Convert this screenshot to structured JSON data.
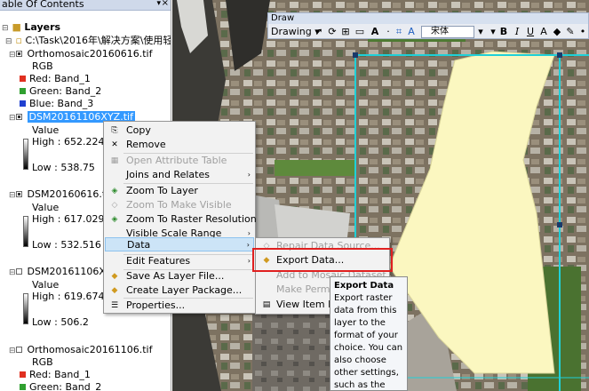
{
  "toc": {
    "title": "able Of Contents",
    "pin": "▾",
    "close": "×",
    "root": "Layers",
    "path": "C:\\Task\\2016年\\解决方案\\使用轻小¦",
    "layers": [
      {
        "name": "Orthomosaic20160616.tif",
        "mode": "RGB",
        "red": "Red:   Band_1",
        "green": "Green: Band_2",
        "blue": "Blue:  Band_3"
      },
      {
        "name": "DSM20161106XYZ.tif",
        "value": "Value",
        "high": "High : 652.224",
        "low": "Low : 538.75"
      },
      {
        "name": "DSM20160616.tif",
        "value": "Value",
        "high": "High : 617.029",
        "low": "Low : 532.516"
      },
      {
        "name": "DSM20161106XY.t",
        "value": "Value",
        "high": "High : 619.674",
        "low": "Low : 506.2"
      },
      {
        "name": "Orthomosaic20161106.tif",
        "mode": "RGB",
        "red": "Red:   Band_1",
        "green": "Green: Band_2"
      }
    ],
    "colors": {
      "red": "#e03020",
      "green": "#30a030",
      "blue": "#2040d0",
      "selection": "#3399ff"
    }
  },
  "draw": {
    "title": "Draw",
    "label": "Drawing",
    "font": "宋体",
    "bold": "B",
    "italic": "I",
    "underline": "U",
    "text": "A"
  },
  "context_menu": {
    "items": [
      {
        "label": "Copy",
        "icon": "copy-icon",
        "enabled": true
      },
      {
        "label": "Remove",
        "icon": "remove-icon",
        "enabled": true
      },
      {
        "label": "Open Attribute Table",
        "icon": "table-icon",
        "enabled": false
      },
      {
        "label": "Joins and Relates",
        "icon": "",
        "enabled": true,
        "submenu": true
      },
      {
        "label": "Zoom To Layer",
        "icon": "zoom-layer-icon",
        "enabled": true
      },
      {
        "label": "Zoom To Make Visible",
        "icon": "zoom-visible-icon",
        "enabled": false
      },
      {
        "label": "Zoom To Raster Resolution",
        "icon": "zoom-resolution-icon",
        "enabled": true
      },
      {
        "label": "Visible Scale Range",
        "icon": "",
        "enabled": true,
        "submenu": true
      },
      {
        "label": "Data",
        "icon": "",
        "enabled": true,
        "submenu": true,
        "highlighted": true
      },
      {
        "label": "Edit Features",
        "icon": "",
        "enabled": true,
        "submenu": true
      },
      {
        "label": "Save As Layer File...",
        "icon": "save-layer-icon",
        "enabled": true
      },
      {
        "label": "Create Layer Package...",
        "icon": "package-icon",
        "enabled": true
      },
      {
        "label": "Properties...",
        "icon": "properties-icon",
        "enabled": true
      }
    ]
  },
  "data_submenu": {
    "items": [
      {
        "label": "Repair Data Source...",
        "enabled": false
      },
      {
        "label": "Export Data...",
        "enabled": true,
        "highlighted": true
      },
      {
        "label": "Add to Mosaic Dataset...",
        "enabled": false
      },
      {
        "label": "Make Permanent",
        "enabled": false
      },
      {
        "label": "View Item Description",
        "enabled": true
      }
    ]
  },
  "tooltip": {
    "title": "Export Data",
    "body": "Export raster data from this layer to the format of your choice. You can also choose other settings, such as the extent of data"
  }
}
